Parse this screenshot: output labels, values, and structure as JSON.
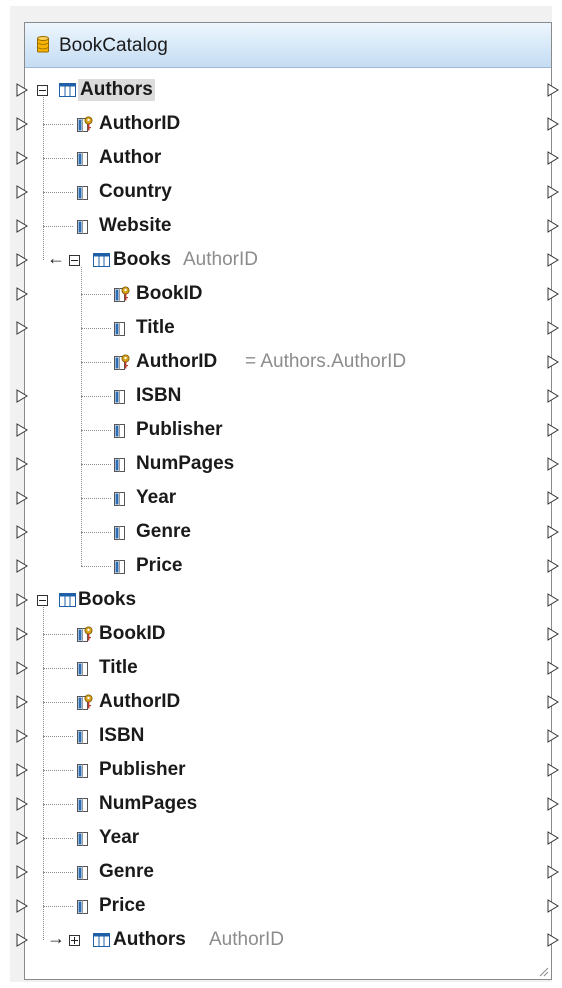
{
  "component": {
    "title": "BookCatalog",
    "icon": "database-icon"
  },
  "tree": {
    "authors": {
      "label": "Authors",
      "columns": [
        {
          "label": "AuthorID",
          "key": true
        },
        {
          "label": "Author",
          "key": false
        },
        {
          "label": "Country",
          "key": false
        },
        {
          "label": "Website",
          "key": false
        }
      ],
      "child_books": {
        "label": "Books",
        "suffix": "AuthorID",
        "columns": [
          {
            "label": "BookID",
            "key": true,
            "suffix": ""
          },
          {
            "label": "Title",
            "key": false,
            "suffix": ""
          },
          {
            "label": "AuthorID",
            "key": true,
            "suffix": "= Authors.AuthorID"
          },
          {
            "label": "ISBN",
            "key": false,
            "suffix": ""
          },
          {
            "label": "Publisher",
            "key": false,
            "suffix": ""
          },
          {
            "label": "NumPages",
            "key": false,
            "suffix": ""
          },
          {
            "label": "Year",
            "key": false,
            "suffix": ""
          },
          {
            "label": "Genre",
            "key": false,
            "suffix": ""
          },
          {
            "label": "Price",
            "key": false,
            "suffix": ""
          }
        ]
      }
    },
    "books": {
      "label": "Books",
      "columns": [
        {
          "label": "BookID",
          "key": true
        },
        {
          "label": "Title",
          "key": false
        },
        {
          "label": "AuthorID",
          "key": true
        },
        {
          "label": "ISBN",
          "key": false
        },
        {
          "label": "Publisher",
          "key": false
        },
        {
          "label": "NumPages",
          "key": false
        },
        {
          "label": "Year",
          "key": false
        },
        {
          "label": "Genre",
          "key": false
        },
        {
          "label": "Price",
          "key": false
        }
      ],
      "child_authors": {
        "label": "Authors",
        "suffix": "AuthorID"
      }
    }
  },
  "colors": {
    "header_top": "#eef6fd",
    "header_bottom": "#c5dcf3",
    "table_icon": "#1f5fa8",
    "key_icon": "#d4a017",
    "selection": "#dcdcdc"
  }
}
